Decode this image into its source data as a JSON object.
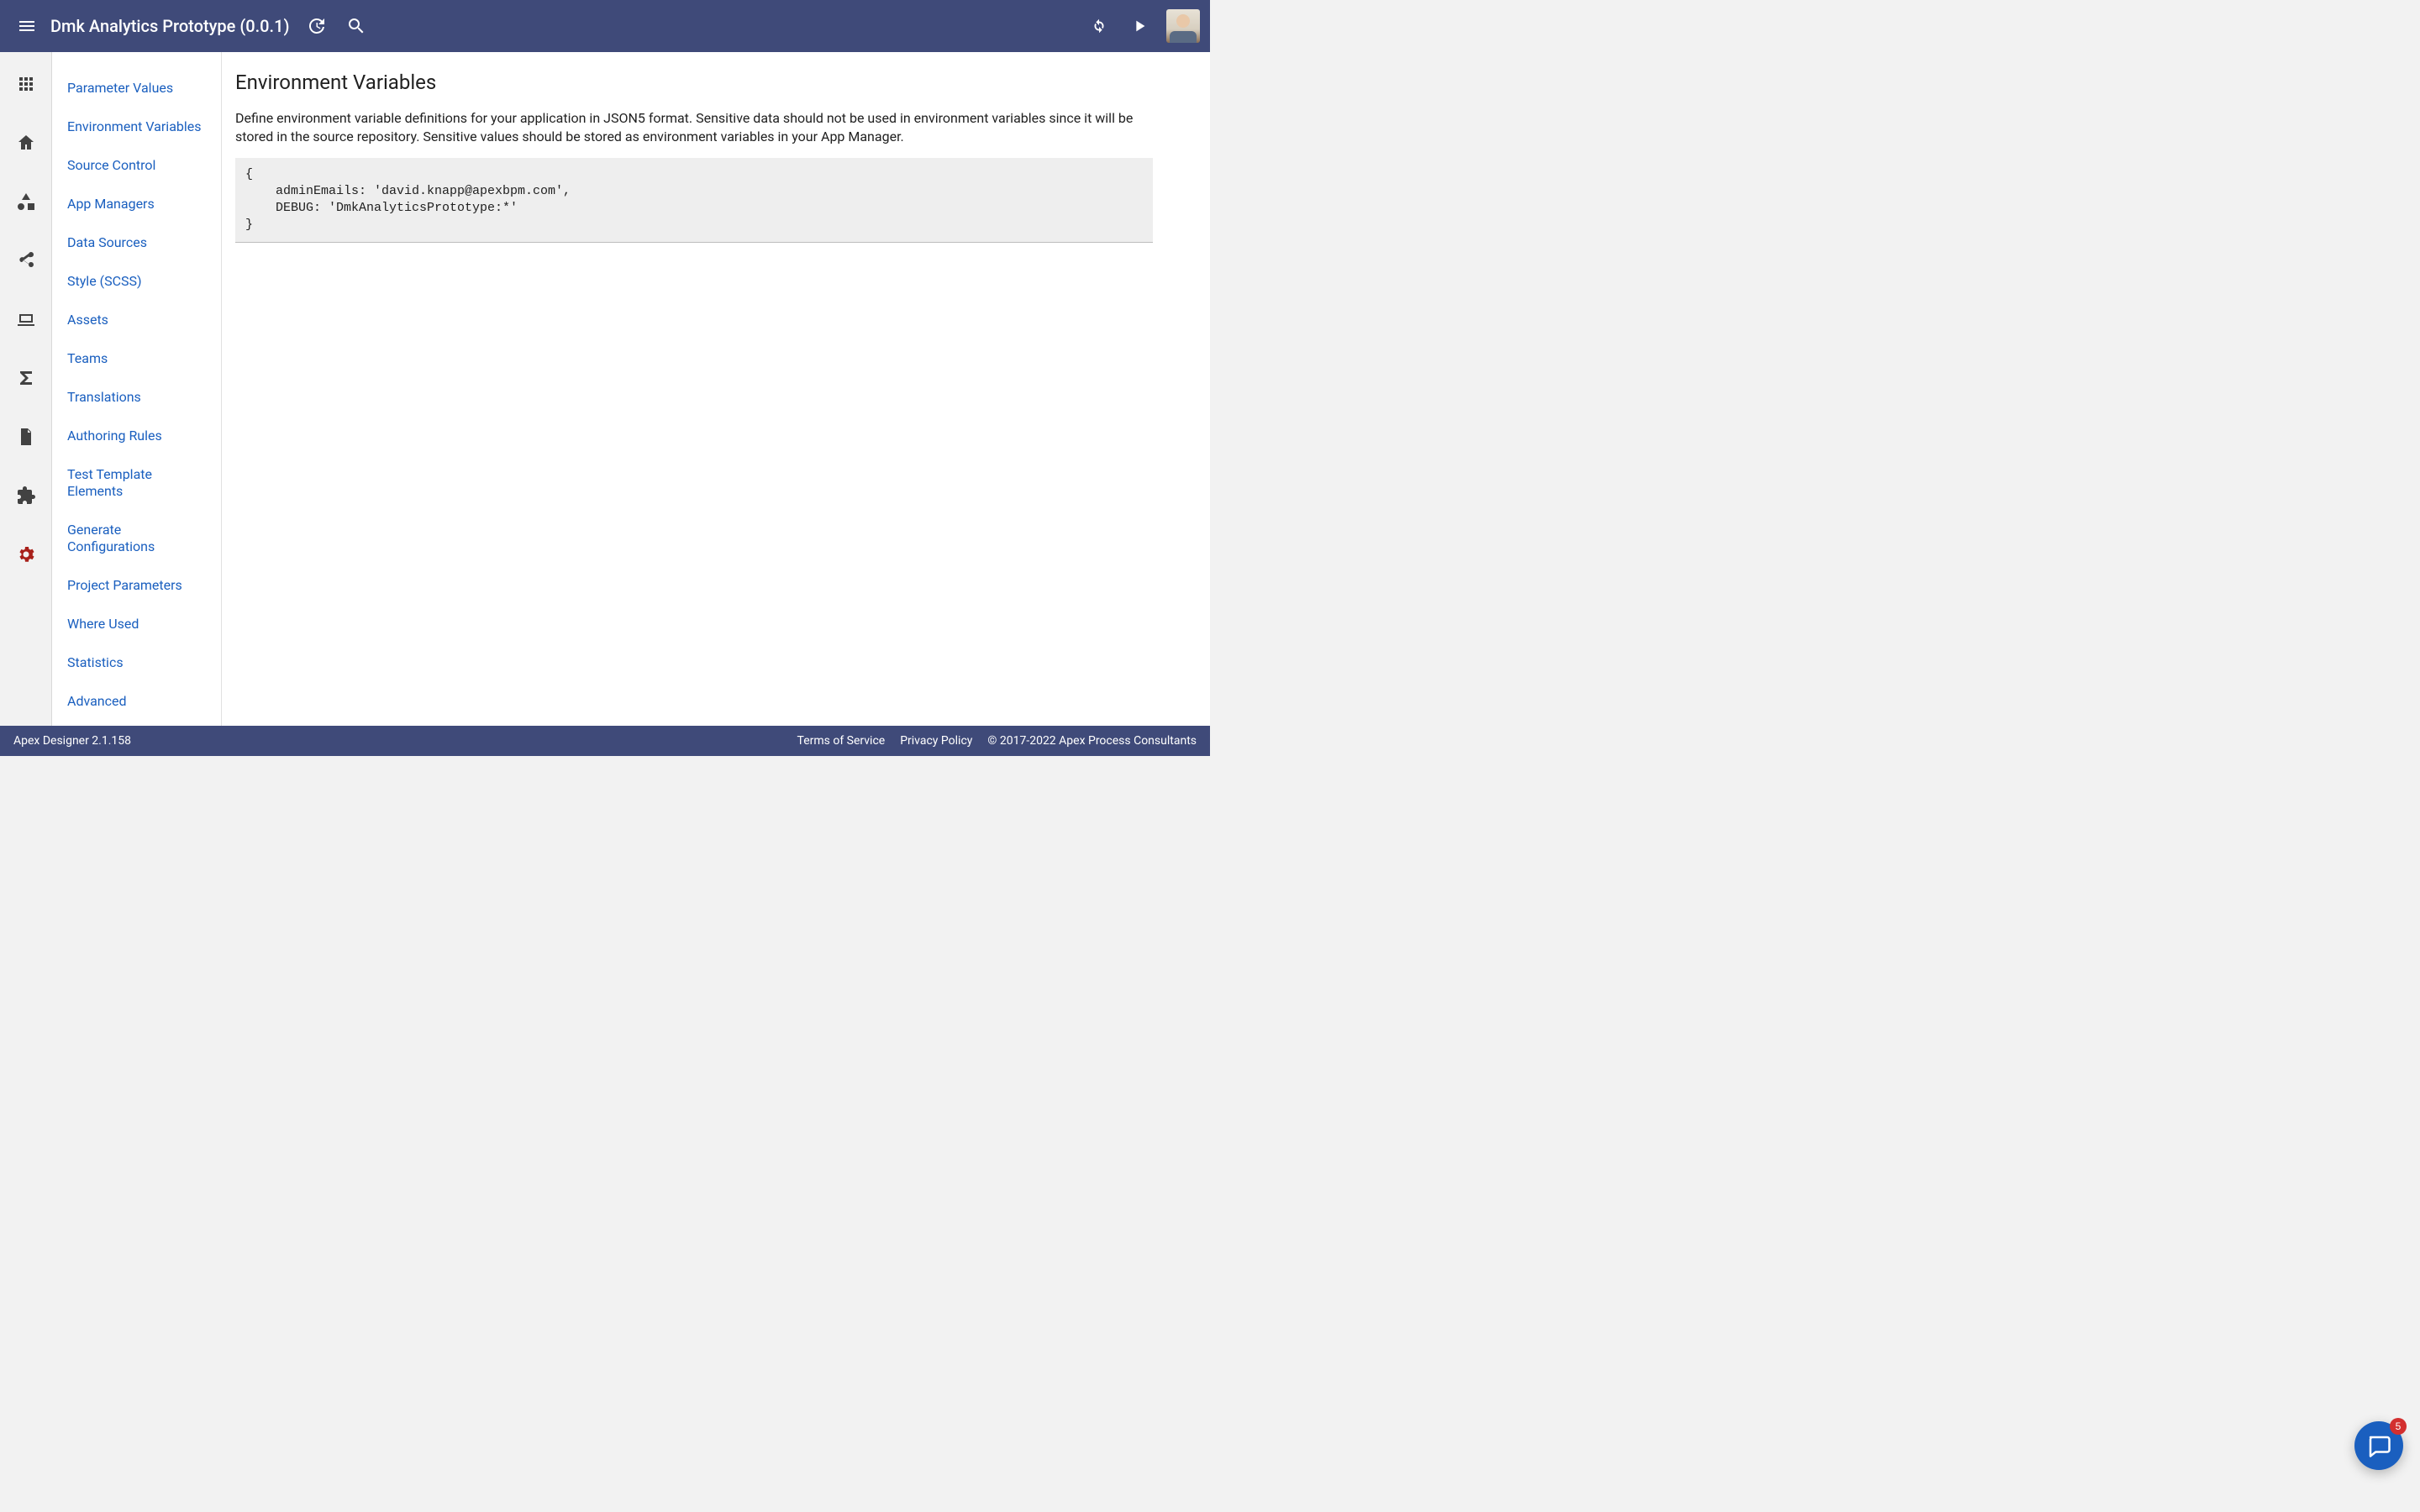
{
  "appbar": {
    "title": "Dmk Analytics Prototype (0.0.1)"
  },
  "rail": {
    "items": [
      {
        "name": "apps-icon"
      },
      {
        "name": "home-icon"
      },
      {
        "name": "shapes-icon"
      },
      {
        "name": "share-icon"
      },
      {
        "name": "laptop-icon"
      },
      {
        "name": "sigma-icon"
      },
      {
        "name": "page-icon"
      },
      {
        "name": "puzzle-icon"
      },
      {
        "name": "settings-icon"
      }
    ]
  },
  "settingsNav": {
    "items": [
      "Parameter Values",
      "Environment Variables",
      "Source Control",
      "App Managers",
      "Data Sources",
      "Style (SCSS)",
      "Assets",
      "Teams",
      "Translations",
      "Authoring Rules",
      "Test Template Elements",
      "Generate Configurations",
      "Project Parameters",
      "Where Used",
      "Statistics",
      "Advanced"
    ]
  },
  "main": {
    "heading": "Environment Variables",
    "description": "Define environment variable definitions for your application in JSON5 format. Sensitive data should not be used in environment variables since it will be stored in the source repository. Sensitive values should be stored as environment variables in your App Manager.",
    "code": "{\n    adminEmails: 'david.knapp@apexbpm.com',\n    DEBUG: 'DmkAnalyticsPrototype:*'\n}"
  },
  "footer": {
    "version": "Apex Designer 2.1.158",
    "terms": "Terms of Service",
    "privacy": "Privacy Policy",
    "copyright": "© 2017-2022 Apex Process Consultants"
  },
  "chat": {
    "badge": "5"
  }
}
